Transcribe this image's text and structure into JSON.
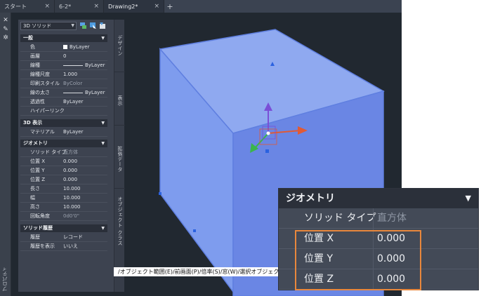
{
  "tabs": [
    {
      "label": "スタート",
      "close": "×"
    },
    {
      "label": "6-2*",
      "close": "×"
    },
    {
      "label": "Drawing2*",
      "close": "×"
    }
  ],
  "tab_plus": "+",
  "left_strip": {
    "close_icon": "×",
    "pin_icon": "pin",
    "settings_icon": "gear",
    "label": "プロパティ"
  },
  "palette": {
    "selector": "3D ソリッド",
    "sections": {
      "general": "一般",
      "display3d": "3D 表示",
      "geometry": "ジオメトリ",
      "history": "ソリッド履歴"
    },
    "general_rows": [
      {
        "label": "色",
        "value": "ByLayer"
      },
      {
        "label": "画層",
        "value": "0"
      },
      {
        "label": "線種",
        "value": "ByLayer"
      },
      {
        "label": "線種尺度",
        "value": "1.000"
      },
      {
        "label": "印刷スタイル",
        "value": "ByColor"
      },
      {
        "label": "線の太さ",
        "value": "ByLayer"
      },
      {
        "label": "透過性",
        "value": "ByLayer"
      },
      {
        "label": "ハイパーリンク",
        "value": ""
      }
    ],
    "display_rows": [
      {
        "label": "マテリアル",
        "value": "ByLayer"
      }
    ],
    "geometry_rows": [
      {
        "label": "ソリッド タイプ",
        "value": "直方体"
      },
      {
        "label": "位置 X",
        "value": "0.000"
      },
      {
        "label": "位置 Y",
        "value": "0.000"
      },
      {
        "label": "位置 Z",
        "value": "0.000"
      },
      {
        "label": "長さ",
        "value": "10.000"
      },
      {
        "label": "幅",
        "value": "10.000"
      },
      {
        "label": "高さ",
        "value": "10.000"
      },
      {
        "label": "回転角度",
        "value": "0d0'0\""
      }
    ],
    "history_rows": [
      {
        "label": "履歴",
        "value": "レコード"
      },
      {
        "label": "履歴を表示",
        "value": "いいえ"
      }
    ]
  },
  "side_tabs": [
    "デザイン",
    "表示",
    "拡張データ",
    "オブジェクト クラス"
  ],
  "command_line": "/オブジェクト範囲(E)/前画面(P)/倍率(S)/窓(W)/選択オブジェクト",
  "zoom_panel": {
    "title": "ジオメトリ",
    "rows": [
      {
        "label": "ソリッド タイプ",
        "value": "直方体"
      },
      {
        "label": "位置 X",
        "value": "0.000"
      },
      {
        "label": "位置 Y",
        "value": "0.000"
      },
      {
        "label": "位置 Z",
        "value": "0.000"
      }
    ]
  },
  "colors": {
    "viewport_bg": "#212830",
    "cube_face_light": "#8fa9f0",
    "cube_face_dark": "#6a86e4",
    "highlight": "#e8873c"
  }
}
